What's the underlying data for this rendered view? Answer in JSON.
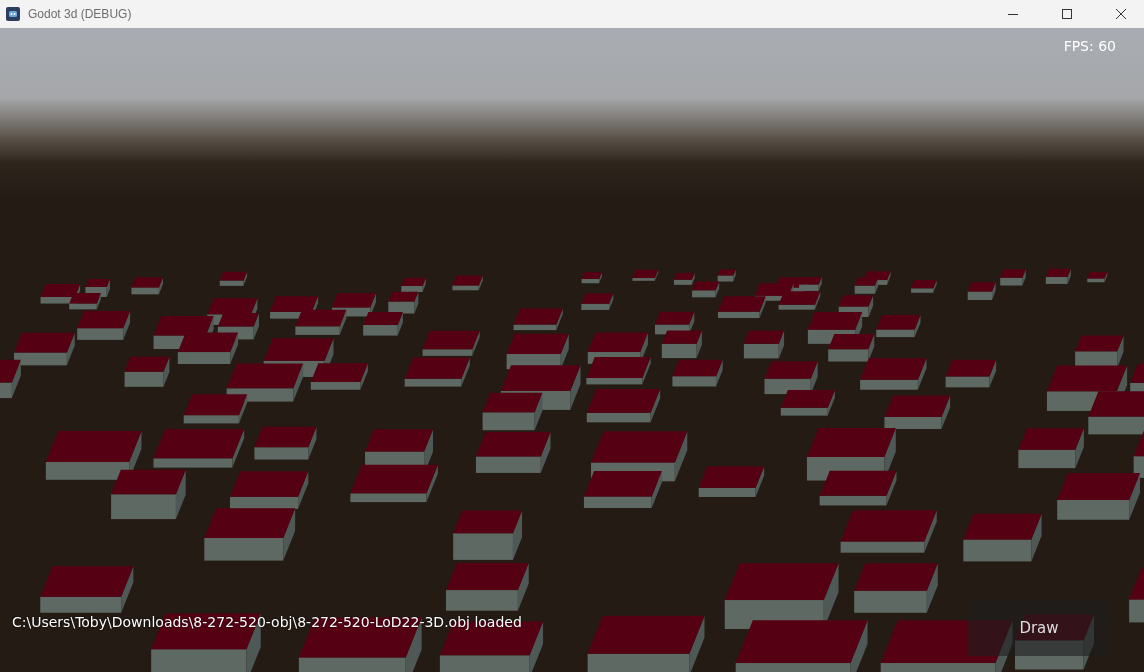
{
  "window": {
    "title": "Godot 3d (DEBUG)"
  },
  "viewport": {
    "fps": "FPS: 60",
    "status": "C:\\Users\\Toby\\Downloads\\8-272-520-obj\\8-272-520-LoD22-3D.obj loaded",
    "draw_button": "Draw"
  }
}
